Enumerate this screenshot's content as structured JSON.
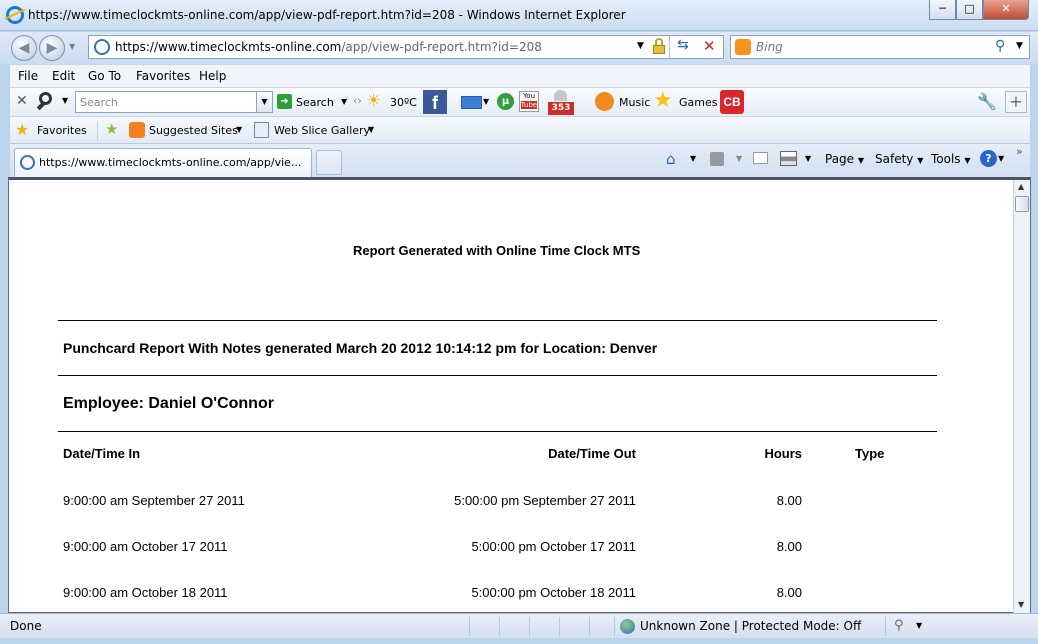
{
  "window": {
    "title": "https://www.timeclockmts-online.com/app/view-pdf-report.htm?id=208 - Windows Internet Explorer",
    "minimize": "─",
    "maximize": "□",
    "close": "✕"
  },
  "address_bar": {
    "url_prefix": "https://www.timeclockmts-online.com",
    "url_rest": "/app/view-pdf-report.htm?id=208",
    "search_placeholder": "Bing"
  },
  "menu": [
    "File",
    "Edit",
    "Go To",
    "Favorites",
    "Help"
  ],
  "toolbar": {
    "search_placeholder": "Search",
    "search_label": "Search",
    "weather": "30ºC",
    "music": "Music",
    "games": "Games",
    "mail_count": "353"
  },
  "favorites_bar": {
    "favorites": "Favorites",
    "suggested_sites": "Suggested Sites",
    "web_slice_gallery": "Web Slice Gallery"
  },
  "tab": {
    "title": "https://www.timeclockmts-online.com/app/vie..."
  },
  "command_bar": {
    "page": "Page",
    "safety": "Safety",
    "tools": "Tools"
  },
  "report": {
    "generated_by": "Report Generated with Online Time Clock MTS",
    "heading": "Punchcard Report With Notes generated March 20 2012 10:14:12 pm for Location: Denver",
    "employee": "Employee: Daniel O'Connor",
    "columns": [
      "Date/Time In",
      "Date/Time Out",
      "Hours",
      "Type"
    ],
    "rows": [
      {
        "in": "9:00:00 am September 27 2011",
        "out": "5:00:00 pm September 27 2011",
        "hours": "8.00",
        "type": ""
      },
      {
        "in": "9:00:00 am October 17 2011",
        "out": "5:00:00 pm October 17 2011",
        "hours": "8.00",
        "type": ""
      },
      {
        "in": "9:00:00 am October 18 2011",
        "out": "5:00:00 pm October 18 2011",
        "hours": "8.00",
        "type": ""
      }
    ]
  },
  "status": {
    "left": "Done",
    "zone": "Unknown Zone | Protected Mode: Off"
  },
  "colors": {
    "chrome": "#cadcf0",
    "close_button": "#c24a32",
    "facebook": "#3b5998",
    "cb_red": "#d9262b"
  }
}
